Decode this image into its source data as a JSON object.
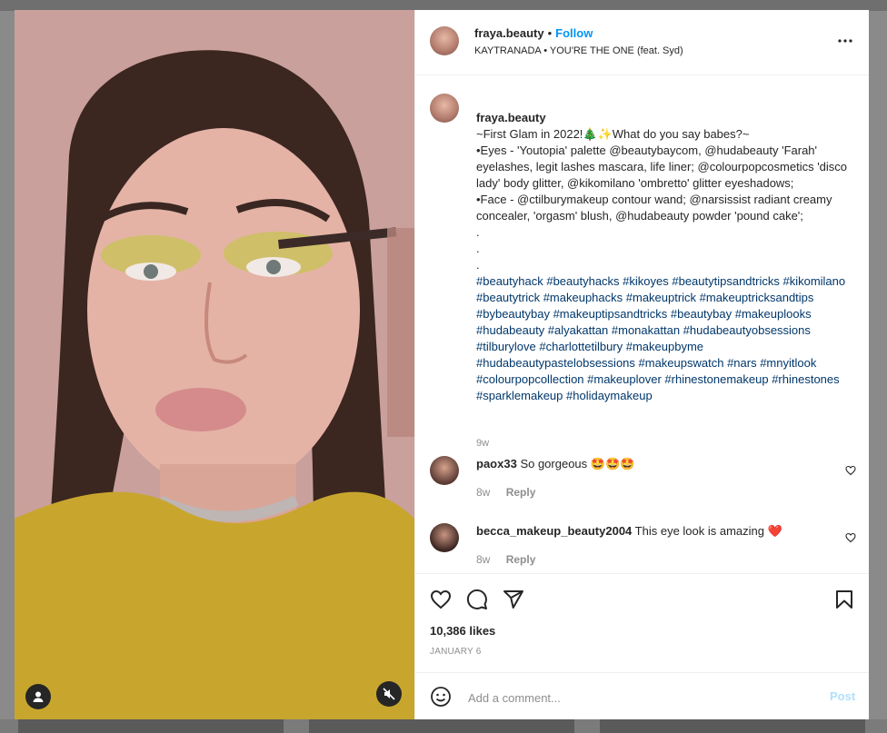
{
  "post": {
    "username": "fraya.beauty",
    "follow_label": "Follow",
    "dot": "•",
    "audio": "KAYTRANADA • YOU'RE THE ONE (feat. Syd)",
    "caption_lines": "~First Glam in 2022!🎄✨What do you say babes?~\n•Eyes - 'Youtopia' palette @beautybaycom, @hudabeauty 'Farah' eyelashes, legit lashes mascara, life liner; @colourpopcosmetics 'disco lady' body glitter, @kikomilano 'ombretto' glitter eyeshadows;\n•Face - @ctilburymakeup contour wand; @narsissist radiant creamy concealer, 'orgasm' blush, @hudabeauty powder 'pound cake';\n.\n.\n.",
    "hashtags": "#beautyhack #beautyhacks #kikoyes #beautytipsandtricks #kikomilano #beautytrick #makeuphacks #makeuptrick #makeuptricksandtips #bybeautybay #makeuptipsandtricks #beautybay #makeuplooks #hudabeauty #alyakattan #monakattan #hudabeautyobsessions #tilburylove #charlottetilbury #makeupbyme #hudabeautypastelobsessions #makeupswatch #nars #mnyitlook #colourpopcollection #makeuplover #rhinestonemakeup #rhinestones #sparklemakeup #holidaymakeup",
    "caption_time": "9w",
    "likes": "10,386 likes",
    "date": "JANUARY 6"
  },
  "comments": [
    {
      "username": "paox33",
      "text": "So gorgeous 🤩🤩🤩",
      "time": "8w",
      "reply": "Reply"
    },
    {
      "username": "becca_makeup_beauty2004",
      "text": "This eye look is amazing ❤️",
      "time": "8w",
      "reply": "Reply"
    }
  ],
  "add_comment": {
    "placeholder": "Add a comment...",
    "post_label": "Post"
  },
  "icons": [
    "more-icon",
    "heart-icon",
    "comment-icon",
    "share-icon",
    "bookmark-icon",
    "emoji-icon",
    "user-tag-icon",
    "muted-icon"
  ],
  "colors": {
    "accent": "#0095f6",
    "post_disabled": "#b2dffc",
    "hashtag": "#00376b",
    "secondary_text": "#8e8e8e"
  }
}
